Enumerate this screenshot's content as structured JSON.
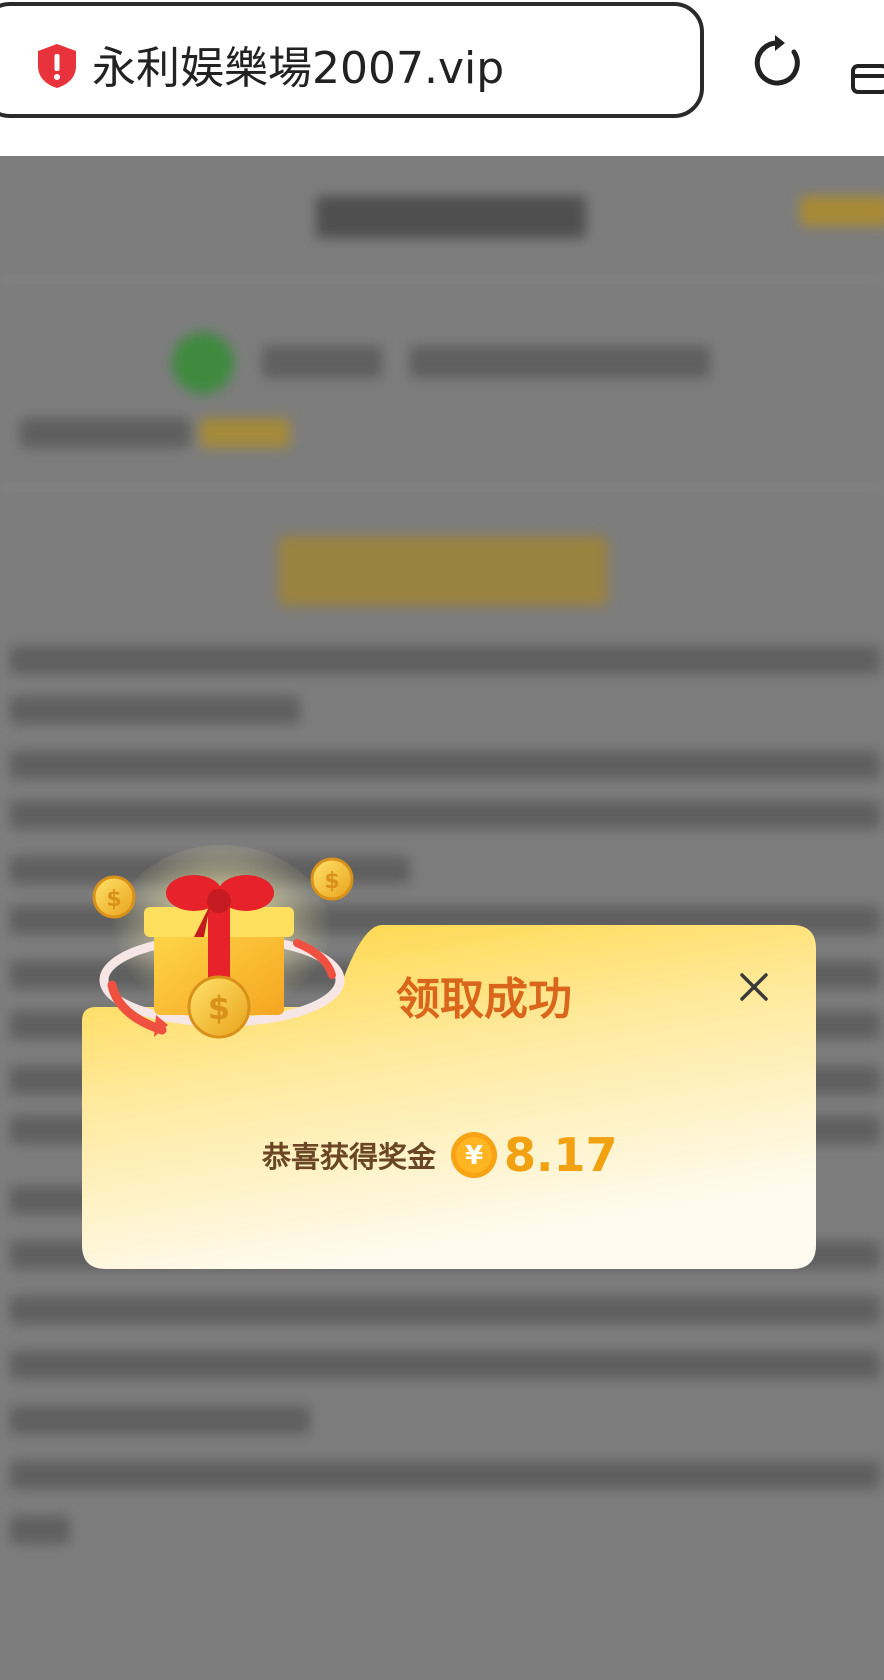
{
  "browser": {
    "url": "永利娱樂場2007.vip",
    "security_icon": "warning-shield-icon",
    "reload_icon": "reload-icon",
    "tabs_icon": "tabs-icon"
  },
  "modal": {
    "title": "领取成功",
    "prize_label": "恭喜获得奖金",
    "currency_symbol": "¥",
    "prize_amount": "8.17",
    "close_icon": "close-icon",
    "illustration": "gift-box-with-coins-icon",
    "colors": {
      "title": "#d9661b",
      "amount": "#f2a110",
      "card_top": "#ffd84a",
      "card_bottom": "#fffaf0"
    }
  }
}
